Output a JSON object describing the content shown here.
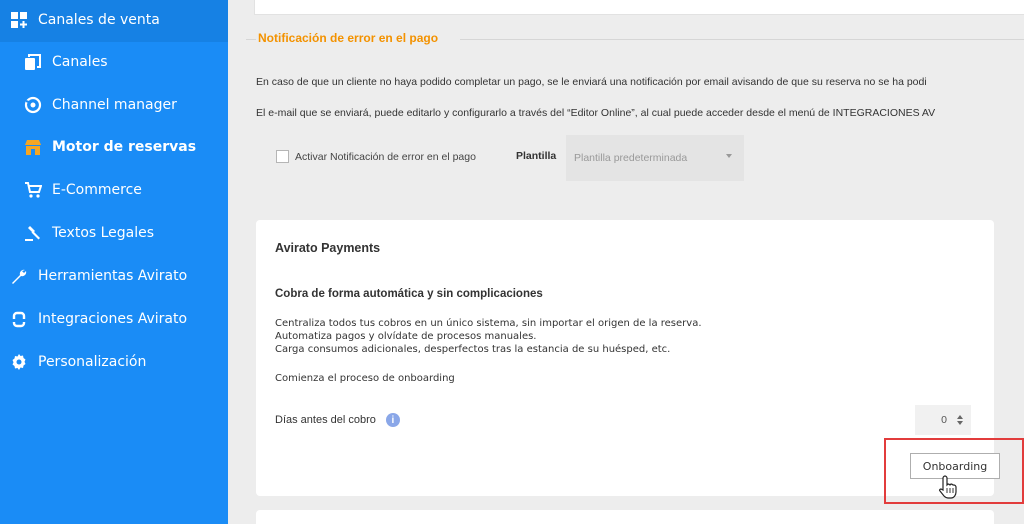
{
  "sidebar": {
    "items": [
      {
        "label": "Canales de venta",
        "icon": "grid-plus-icon"
      },
      {
        "label": "Canales",
        "icon": "copy-icon"
      },
      {
        "label": "Channel manager",
        "icon": "sync-icon"
      },
      {
        "label": "Motor de reservas",
        "icon": "store-icon"
      },
      {
        "label": "E-Commerce",
        "icon": "cart-icon"
      },
      {
        "label": "Textos Legales",
        "icon": "gavel-icon"
      },
      {
        "label": "Herramientas Avirato",
        "icon": "wrench-icon"
      },
      {
        "label": "Integraciones Avirato",
        "icon": "link-icon"
      },
      {
        "label": "Personalización",
        "icon": "gear-icon"
      }
    ],
    "accent_color": "#1a8cf6"
  },
  "error_section": {
    "title": "Notificación de error en el pago",
    "paragraph1": "En caso de que un cliente no haya podido completar un pago, se le enviará una notificación por email avisando de que su reserva no se ha podi",
    "paragraph2": "El e-mail que se enviará, puede editarlo y configurarlo a través del “Editor Online”, al cual puede acceder desde el menú de INTEGRACIONES AV",
    "checkbox_label": "Activar Notificación de error en el pago",
    "template_label": "Plantilla",
    "template_value": "Plantilla predeterminada",
    "accent_color": "#f39200"
  },
  "payments": {
    "title": "Avirato Payments",
    "subtitle": "Cobra de forma automática y sin complicaciones",
    "lines": [
      "Centraliza todos tus cobros en un único sistema, sin importar el origen de la reserva.",
      "Automatiza pagos y olvídate de procesos manuales.",
      "Carga consumos adicionales, desperfectos tras la estancia de su huésped, etc."
    ],
    "onboarding_text": "Comienza el proceso de onboarding",
    "days_label": "Días antes del cobro",
    "info_glyph": "i",
    "days_value": "0",
    "button_label": "Onboarding"
  }
}
